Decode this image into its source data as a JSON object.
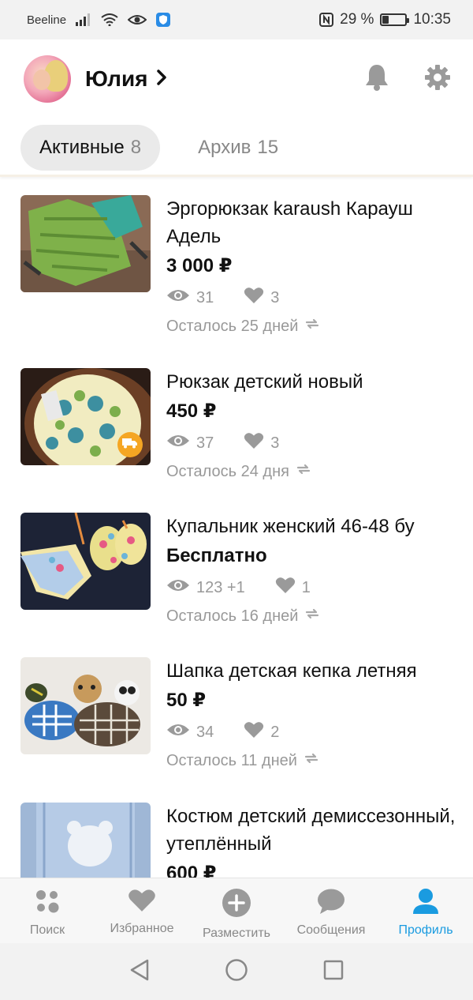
{
  "status_bar": {
    "carrier": "Beeline",
    "battery_percent": "29 %",
    "battery_level": 0.29,
    "time": "10:35"
  },
  "header": {
    "username": "Юлия"
  },
  "tabs": [
    {
      "label": "Активные",
      "count": "8",
      "active": true
    },
    {
      "label": "Архив",
      "count": "15",
      "active": false
    }
  ],
  "listings": [
    {
      "title": "Эргорюкзак karaush Карауш Адель",
      "price": "3 000 ₽",
      "views": "31",
      "likes": "3",
      "remaining": "Осталось 25 дней"
    },
    {
      "title": "Рюкзак детский новый",
      "price": "450 ₽",
      "views": "37",
      "likes": "3",
      "remaining": "Осталось 24 дня",
      "delivery_badge": true
    },
    {
      "title": "Купальник женский 46-48 бу",
      "price": "Бесплатно",
      "views": "123 +1",
      "likes": "1",
      "remaining": "Осталось 16 дней"
    },
    {
      "title": "Шапка детская кепка летняя",
      "price": "50 ₽",
      "views": "34",
      "likes": "2",
      "remaining": "Осталось 11 дней"
    },
    {
      "title": "Костюм детский демиссезонный, утеплённый",
      "price": "600 ₽"
    }
  ],
  "bottom_nav": [
    {
      "label": "Поиск",
      "icon": "search-dots-icon",
      "active": false
    },
    {
      "label": "Избранное",
      "icon": "heart-icon",
      "active": false
    },
    {
      "label": "Разместить",
      "icon": "plus-circle-icon",
      "active": false
    },
    {
      "label": "Сообщения",
      "icon": "chat-icon",
      "active": false
    },
    {
      "label": "Профиль",
      "icon": "profile-icon",
      "active": true
    }
  ],
  "colors": {
    "accent": "#1a9be0",
    "muted_text": "#999999",
    "tab_active_bg": "#eaeaea",
    "delivery_badge": "#f5a623"
  }
}
